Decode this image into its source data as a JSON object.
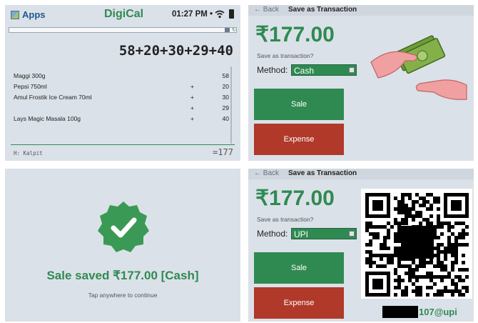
{
  "calc": {
    "apps_label": "Apps",
    "brand": "DigiCal",
    "clock": "01:27 PM •",
    "expression": "58+20+30+29+40",
    "rows": [
      {
        "item": "Maggi 300g",
        "op": "",
        "value": "58"
      },
      {
        "item": "Pepsi 750ml",
        "op": "+",
        "value": "20"
      },
      {
        "item": "Amul Frostik Ice Cream 70ml",
        "op": "+",
        "value": "30"
      },
      {
        "item": "",
        "op": "+",
        "value": "29"
      },
      {
        "item": "Lays Magic Masala 100g",
        "op": "+",
        "value": "40"
      }
    ],
    "history_label": "H: Kalpit",
    "total": "=177"
  },
  "cash_screen": {
    "back": "← Back",
    "title": "Save as Transaction",
    "amount": "₹177.00",
    "question": "Save as transaction?",
    "method_label": "Method:",
    "method_value": "Cash",
    "sale_label": "Sale",
    "expense_label": "Expense"
  },
  "saved_screen": {
    "message": "Sale saved  ₹177.00 [Cash]",
    "hint": "Tap anywhere to continue"
  },
  "upi_screen": {
    "back": "← Back",
    "title": "Save as Transaction",
    "amount": "₹177.00",
    "question": "Save as transaction?",
    "method_label": "Method:",
    "method_value": "UPI",
    "sale_label": "Sale",
    "expense_label": "Expense",
    "upi_id_visible": "107@upi"
  },
  "colors": {
    "green": "#2f8a52",
    "red": "#b0392a",
    "panel": "#dbe1e8"
  },
  "icons": [
    "apps-icon",
    "wifi-icon",
    "battery-icon",
    "cash-hands-icon",
    "checkmark-badge-icon",
    "qr-code"
  ]
}
